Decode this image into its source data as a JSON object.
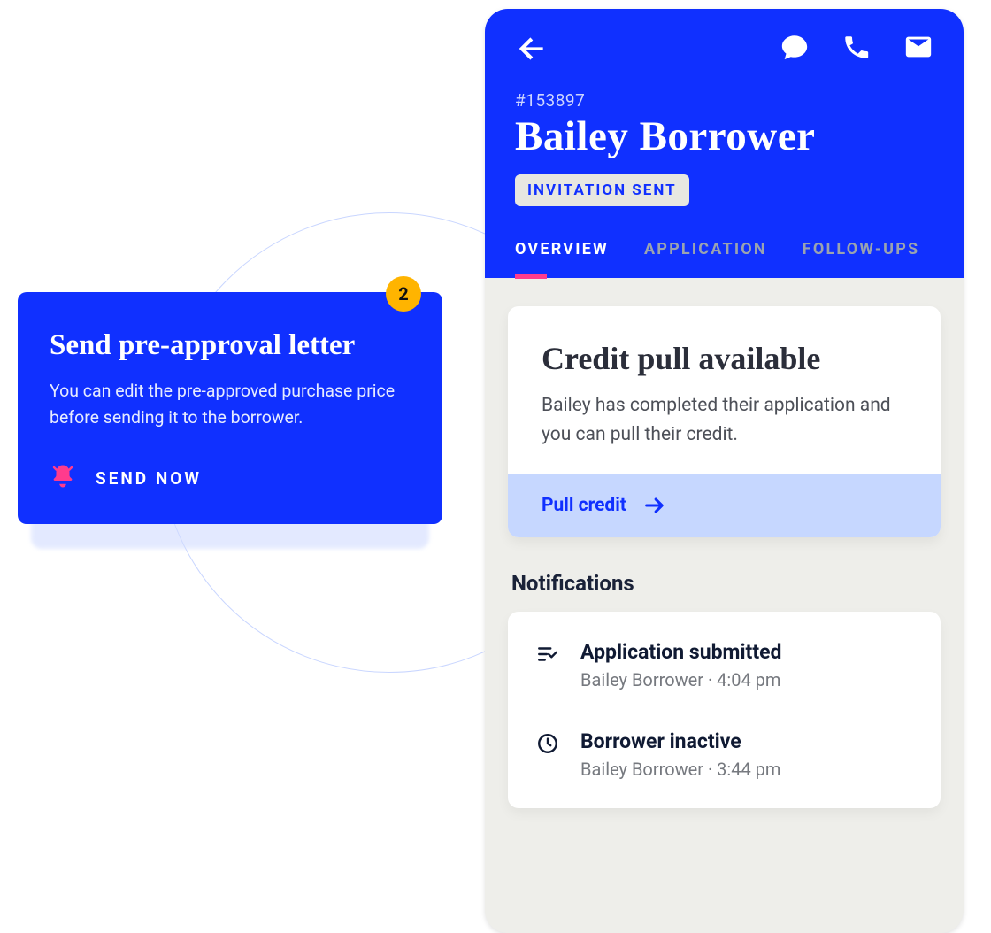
{
  "preapproval": {
    "title": "Send pre-approval letter",
    "description": "You can edit the pre-approved purchase price before sending it to the borrower.",
    "send_now_label": "SEND NOW",
    "badge_count": "2"
  },
  "borrower": {
    "case_id": "#153897",
    "name": "Bailey Borrower",
    "status": "INVITATION SENT",
    "tabs": [
      {
        "label": "OVERVIEW"
      },
      {
        "label": "APPLICATION"
      },
      {
        "label": "FOLLOW-UPS"
      }
    ],
    "active_tab": 0,
    "credit_card": {
      "title": "Credit pull available",
      "body": "Bailey has completed their application and you can pull their credit.",
      "action_label": "Pull credit"
    },
    "notifications_heading": "Notifications",
    "notifications": [
      {
        "title": "Application submitted",
        "meta": "Bailey Borrower · 4:04 pm"
      },
      {
        "title": "Borrower inactive",
        "meta": "Bailey Borrower · 3:44 pm"
      }
    ]
  }
}
